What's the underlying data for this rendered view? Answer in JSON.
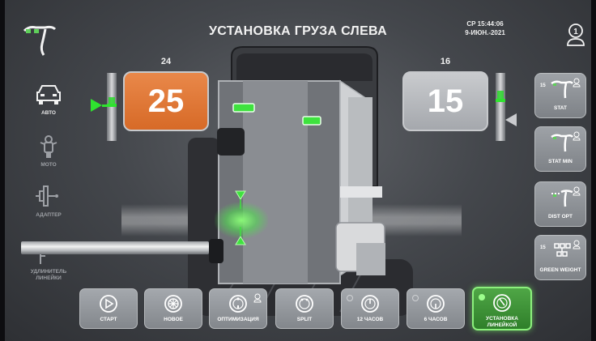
{
  "header": {
    "title": "УСТАНОВКА ГРУЗА СЛЕВА",
    "datetime_line1": "СР 15:44:06",
    "datetime_line2": "9-ИЮН.-2021",
    "user_badge_number": "1"
  },
  "left_menu": [
    {
      "label": "АВТО",
      "icon": "car-icon",
      "active": true
    },
    {
      "label": "МОТО",
      "icon": "motorcycle-icon",
      "active": false
    },
    {
      "label": "АДАПТЕР",
      "icon": "adapter-icon",
      "active": false
    },
    {
      "label_line1": "УДЛИНИТЕЛЬ",
      "label_line2": "ЛИНЕЙКИ",
      "icon": "ruler-extension-icon",
      "active": false
    }
  ],
  "weights": {
    "left": {
      "label": "24",
      "value": "25",
      "color": "#e07a35"
    },
    "right": {
      "label": "16",
      "value": "15",
      "color": "#b7b9bd"
    }
  },
  "right_menu": [
    {
      "label": "STAT",
      "prefix": "15",
      "icon": "stat-weight-icon"
    },
    {
      "label": "STAT MIN",
      "prefix": "",
      "icon": "stat-min-icon"
    },
    {
      "label": "DIST OPT",
      "prefix": "",
      "icon": "dist-opt-icon"
    },
    {
      "label": "GREEN WEIGHT",
      "prefix": "15",
      "icon": "green-weight-icon"
    }
  ],
  "bottom_buttons": [
    {
      "label": "СТАРТ",
      "icon": "play-icon"
    },
    {
      "label": "НОВОЕ",
      "icon": "wheel-new-icon"
    },
    {
      "label": "ОПТИМИЗАЦИЯ",
      "icon": "optimization-icon"
    },
    {
      "label": "SPLIT",
      "icon": "split-icon"
    },
    {
      "label": "12 ЧАСОВ",
      "icon": "clock-12-icon"
    },
    {
      "label": "6 ЧАСОВ",
      "icon": "clock-6-icon"
    },
    {
      "label_line1": "УСТАНОВКА",
      "label_line2": "ЛИНЕЙКОЙ",
      "icon": "ruler-mount-icon",
      "active": true
    }
  ],
  "colors": {
    "accent_green": "#2fe22f",
    "active_button": "#3e9437",
    "left_weight_orange": "#e07a35"
  }
}
